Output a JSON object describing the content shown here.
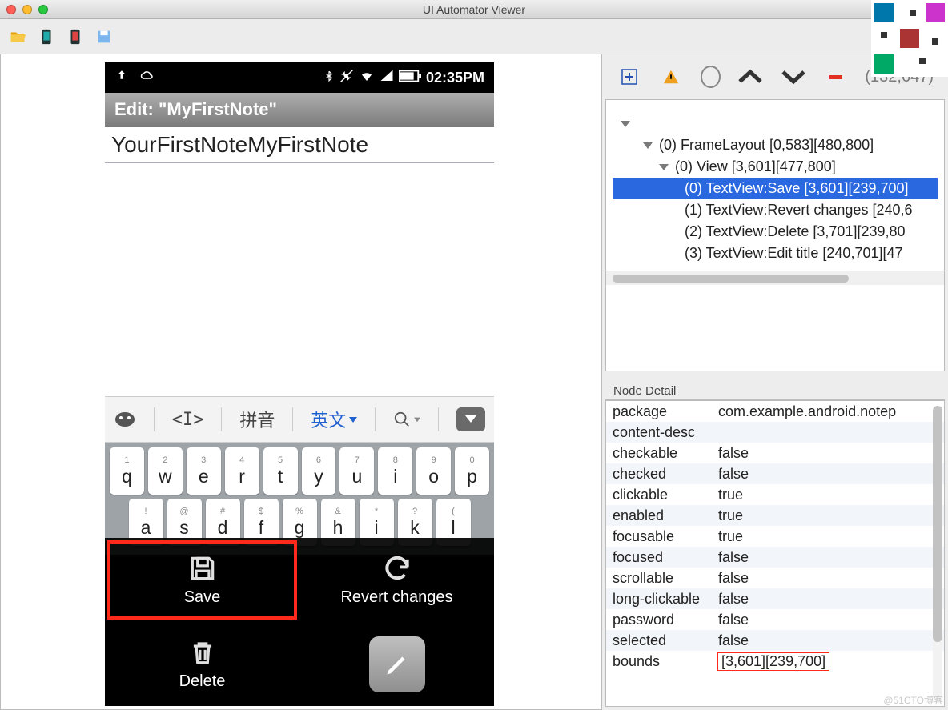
{
  "window": {
    "title": "UI Automator Viewer"
  },
  "coords": "(132,647)",
  "device": {
    "time": "02:35PM",
    "editHeader": "Edit: \"MyFirstNote\"",
    "noteText": "YourFirstNoteMyFirstNote",
    "ime": {
      "pinyin": "拼音",
      "english": "英文"
    },
    "keyboard": {
      "row1": [
        {
          "n": "1",
          "c": "q"
        },
        {
          "n": "2",
          "c": "w"
        },
        {
          "n": "3",
          "c": "e"
        },
        {
          "n": "4",
          "c": "r"
        },
        {
          "n": "5",
          "c": "t"
        },
        {
          "n": "6",
          "c": "y"
        },
        {
          "n": "7",
          "c": "u"
        },
        {
          "n": "8",
          "c": "i"
        },
        {
          "n": "9",
          "c": "o"
        },
        {
          "n": "0",
          "c": "p"
        }
      ],
      "row2": [
        {
          "n": "!",
          "c": "a"
        },
        {
          "n": "@",
          "c": "s"
        },
        {
          "n": "#",
          "c": "d"
        },
        {
          "n": "$",
          "c": "f"
        },
        {
          "n": "%",
          "c": "g"
        },
        {
          "n": "&",
          "c": "h"
        },
        {
          "n": "*",
          "c": "i"
        },
        {
          "n": "?",
          "c": "k"
        },
        {
          "n": "(",
          "c": "l"
        }
      ]
    },
    "menu": {
      "save": "Save",
      "revert": "Revert changes",
      "delete": "Delete",
      "edit": ""
    }
  },
  "tree": {
    "nodes": [
      {
        "indent": 1,
        "text": "(0) FrameLayout [0,583][480,800]",
        "expandable": true
      },
      {
        "indent": 2,
        "text": "(0) View [3,601][477,800]",
        "expandable": true
      },
      {
        "indent": 3,
        "text": "(0) TextView:Save [3,601][239,700]",
        "selected": true
      },
      {
        "indent": 3,
        "text": "(1) TextView:Revert changes [240,6"
      },
      {
        "indent": 3,
        "text": "(2) TextView:Delete [3,701][239,80"
      },
      {
        "indent": 3,
        "text": "(3) TextView:Edit title [240,701][47"
      }
    ]
  },
  "detailTitle": "Node Detail",
  "details": [
    {
      "k": "package",
      "v": "com.example.android.notep"
    },
    {
      "k": "content-desc",
      "v": ""
    },
    {
      "k": "checkable",
      "v": "false"
    },
    {
      "k": "checked",
      "v": "false"
    },
    {
      "k": "clickable",
      "v": "true"
    },
    {
      "k": "enabled",
      "v": "true"
    },
    {
      "k": "focusable",
      "v": "true"
    },
    {
      "k": "focused",
      "v": "false"
    },
    {
      "k": "scrollable",
      "v": "false"
    },
    {
      "k": "long-clickable",
      "v": "false"
    },
    {
      "k": "password",
      "v": "false"
    },
    {
      "k": "selected",
      "v": "false"
    },
    {
      "k": "bounds",
      "v": "[3,601][239,700]",
      "hl": true
    }
  ],
  "watermark": "@51CTO博客"
}
